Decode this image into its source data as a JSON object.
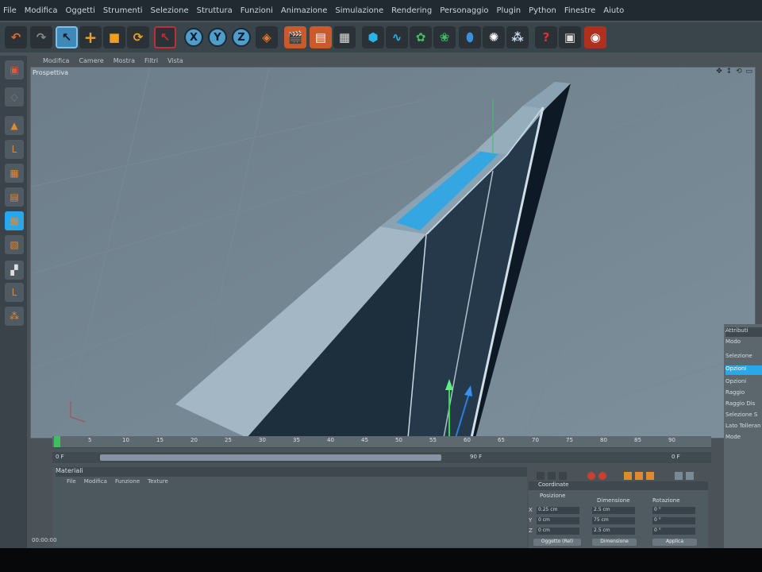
{
  "menu": [
    "File",
    "Modifica",
    "Oggetti",
    "Strumenti",
    "Selezione",
    "Struttura",
    "Funzioni",
    "Animazione",
    "Simulazione",
    "Rendering",
    "Personaggio",
    "Plugin",
    "Python",
    "Finestre",
    "Aiuto"
  ],
  "axes": {
    "x": "X",
    "y": "Y",
    "z": "Z"
  },
  "viewport_tabs": [
    "Modifica",
    "Camere",
    "Mostra",
    "Filtri",
    "Vista"
  ],
  "viewport": {
    "label": "Prospettiva",
    "icons": "✥ ↕ ⟲ ▭"
  },
  "right_panel": [
    "Attributi",
    "Modo",
    "Selezione",
    "Opzioni",
    "Opzioni",
    "Raggio",
    "Raggio Dis",
    "Selezione S",
    "Lato Tolleran",
    "Mode"
  ],
  "timeline": {
    "ticks": [
      "0",
      "5",
      "10",
      "15",
      "20",
      "25",
      "30",
      "35",
      "40",
      "45",
      "50",
      "55",
      "60",
      "65",
      "70",
      "75",
      "80",
      "85",
      "90"
    ],
    "start": "0 F",
    "end": "90 F",
    "current": "0 F"
  },
  "materials": {
    "title": "Materiali",
    "menu": [
      "File",
      "Modifica",
      "Funzione",
      "Texture"
    ]
  },
  "coordinates": {
    "title": "Coordinate",
    "col_position": "Posizione",
    "col_size": "Dimensione",
    "col_rotation": "Rotazione",
    "rows": [
      {
        "axis": "X",
        "pos": "0.25 cm",
        "size": "2.5 cm",
        "rot": "0 °"
      },
      {
        "axis": "Y",
        "pos": "0 cm",
        "size": "75 cm",
        "rot": "0 °"
      },
      {
        "axis": "Z",
        "pos": "0 cm",
        "size": "2.5 cm",
        "rot": "0 °"
      }
    ],
    "btn_mode": "Oggetto (Rel)",
    "btn_size": "Dimensione",
    "btn_apply": "Applica"
  },
  "status": "00:00:00",
  "colors": {
    "accent": "#4e9dcc",
    "highlight": "#2aa7e8",
    "shape_light": "#a5b8c5",
    "shape_dark": "#1f3040"
  }
}
